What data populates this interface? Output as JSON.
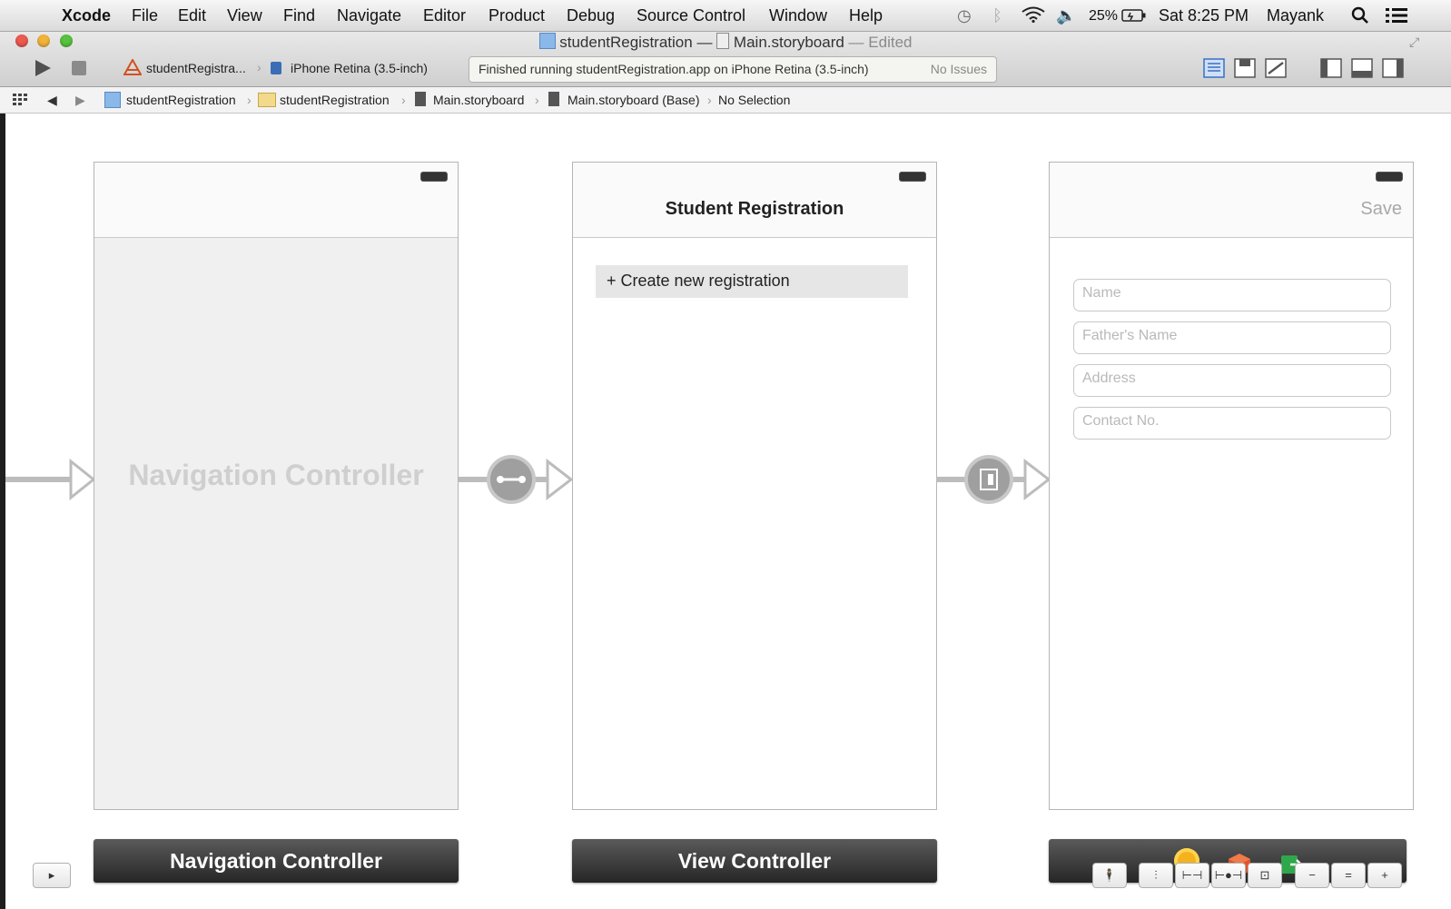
{
  "menubar": {
    "app": "Xcode",
    "items": [
      "File",
      "Edit",
      "View",
      "Find",
      "Navigate",
      "Editor",
      "Product",
      "Debug",
      "Source Control",
      "Window",
      "Help"
    ],
    "battery": "25%",
    "clock": "Sat 8:25 PM",
    "user": "Mayank"
  },
  "window": {
    "project": "studentRegistration",
    "separator": "—",
    "file": "Main.storyboard",
    "state": "— Edited"
  },
  "toolbar": {
    "scheme": "studentRegistra...",
    "device": "iPhone Retina (3.5-inch)",
    "status": "Finished running studentRegistration.app on iPhone Retina (3.5-inch)",
    "issues": "No Issues"
  },
  "jumpbar": {
    "crumbs": [
      "studentRegistration",
      "studentRegistration",
      "Main.storyboard",
      "Main.storyboard (Base)",
      "No Selection"
    ]
  },
  "scenes": {
    "nav": {
      "watermark": "Navigation Controller",
      "dock": "Navigation Controller"
    },
    "vc": {
      "title": "Student Registration",
      "cell": "+ Create new registration",
      "dock": "View Controller"
    },
    "form": {
      "save": "Save",
      "fields": [
        "Name",
        "Father's Name",
        "Address",
        "Contact No."
      ]
    }
  },
  "colors": {
    "dock_dark": "#2b2b2b",
    "segue_gray": "#9f9f9f"
  }
}
